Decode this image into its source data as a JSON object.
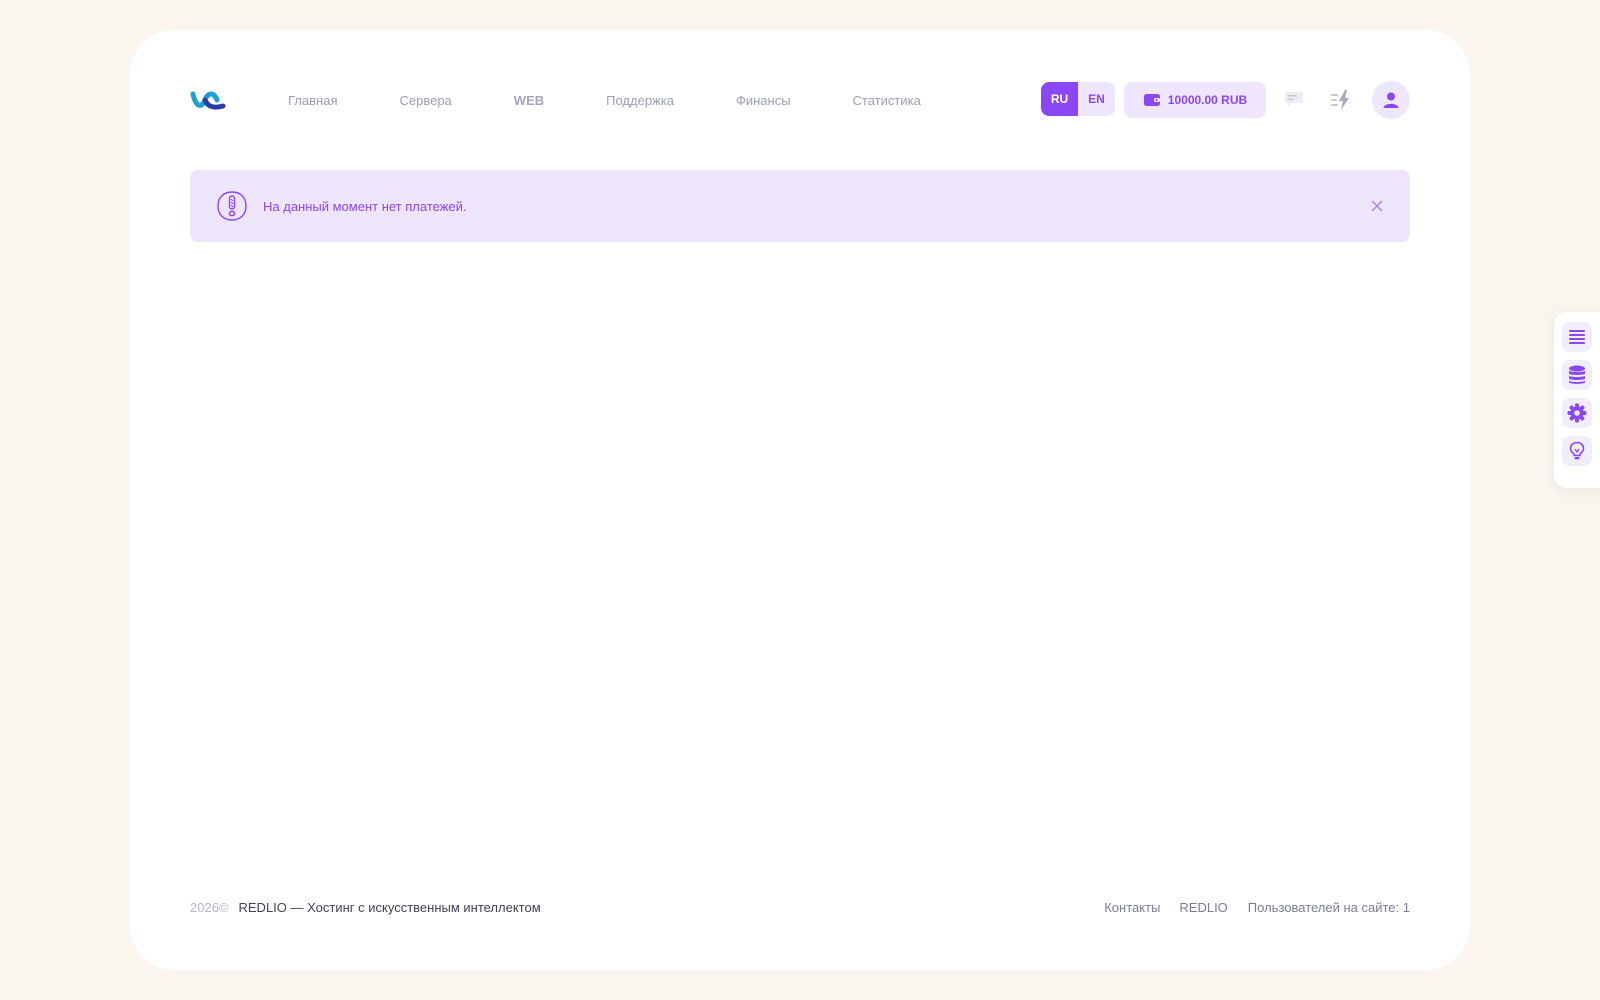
{
  "nav": {
    "items": [
      "Главная",
      "Сервера",
      "WEB",
      "Поддержка",
      "Финансы",
      "Статистика"
    ]
  },
  "lang": {
    "ru": "RU",
    "en": "EN",
    "selected": "RU"
  },
  "balance": {
    "amount": "10000.00 RUB"
  },
  "alert": {
    "message": "На данный момент нет платежей."
  },
  "footer": {
    "year": "2026©",
    "tagline": "REDLIO — Хостинг с искусственным интеллектом",
    "links": [
      "Контакты",
      "REDLIO"
    ],
    "online": "Пользователей на сайте: 1"
  },
  "icons": {
    "logo": "brand-wave-logo",
    "wallet": "wallet-icon",
    "chat": "chat-icon",
    "bolt": "lightning-icon",
    "user": "user-icon",
    "alert": "exclamation-icon",
    "close": "close-icon",
    "side": [
      "list-icon",
      "database-icon",
      "gear-icon",
      "lightbulb-icon"
    ]
  },
  "colors": {
    "accent": "#8b47f5",
    "accent_soft": "#ede6fc",
    "page_bg": "#faf5ee",
    "logo_blue": "#1e9fd6"
  }
}
